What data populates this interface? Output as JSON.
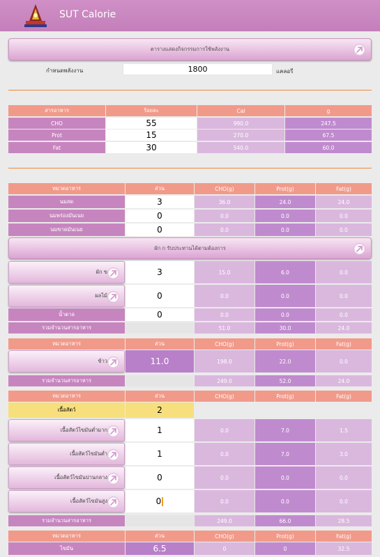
{
  "app": {
    "title": "SUT Calorie"
  },
  "activity_banner": {
    "label": "ตารางแสดงกิจกรรมการใช้พลังงาน"
  },
  "energy": {
    "label": "กำหนดพลังงาน",
    "value": "1800",
    "unit": "แคลอรี"
  },
  "nutrient_table": {
    "headers": [
      "สารอาหาร",
      "ร้อยละ",
      "Cal",
      "g"
    ],
    "rows": [
      {
        "name": "CHO",
        "percent": "55",
        "cal": "990.0",
        "g": "247.5"
      },
      {
        "name": "Prot",
        "percent": "15",
        "cal": "270.0",
        "g": "67.5"
      },
      {
        "name": "Fat",
        "percent": "30",
        "cal": "540.0",
        "g": "60.0"
      }
    ]
  },
  "food_headers": [
    "หมวดอาหาร",
    "ส่วน",
    "CHO(g)",
    "Prot(g)",
    "Fat(g)"
  ],
  "milk_rows": [
    {
      "name": "นมสด",
      "portion": "3",
      "cho": "36.0",
      "prot": "24.0",
      "fat": "24.0"
    },
    {
      "name": "นมพร่องมันเนย",
      "portion": "0",
      "cho": "0.0",
      "prot": "0.0",
      "fat": "0.0"
    },
    {
      "name": "นมขาดมันเนย",
      "portion": "0",
      "cho": "0.0",
      "prot": "0.0",
      "fat": "0.0"
    }
  ],
  "veg_banner": {
    "label": "ผัก ก  รับประทานได้ตามต้องการ"
  },
  "veg_rows": [
    {
      "name": "ผัก ข",
      "portion": "3",
      "cho": "15.0",
      "prot": "6.0",
      "fat": "0.0"
    },
    {
      "name": "ผลไม้",
      "portion": "0",
      "cho": "0.0",
      "prot": "0.0",
      "fat": "0.0"
    },
    {
      "name": "น้ำตาล",
      "portion": "0",
      "cho": "0.0",
      "prot": "0.0",
      "fat": "0.0"
    }
  ],
  "total1": {
    "label": "รวมจำนวนสารอาหาร",
    "cho": "51.0",
    "prot": "30.0",
    "fat": "24.0"
  },
  "rice_row": {
    "name": "ข้าว",
    "portion": "11.0",
    "cho": "198.0",
    "prot": "22.0",
    "fat": "0.0"
  },
  "total2": {
    "label": "รวมจำนวนสารอาหาร",
    "cho": "249.0",
    "prot": "52.0",
    "fat": "24.0"
  },
  "meat_header": {
    "name": "เนื้อสัตว์",
    "portion": "2"
  },
  "meat_rows": [
    {
      "name": "เนื้อสัตว์ไขมันต่ำมาก",
      "portion": "1",
      "cho": "0.0",
      "prot": "7.0",
      "fat": "1.5"
    },
    {
      "name": "เนื้อสัตว์ไขมันต่ำ",
      "portion": "1",
      "cho": "0.0",
      "prot": "7.0",
      "fat": "3.0"
    },
    {
      "name": "เนื้อสัตว์ไขมันปานกลาง",
      "portion": "0",
      "cho": "0.0",
      "prot": "0.0",
      "fat": "0.0"
    },
    {
      "name": "เนื้อสัตว์ไขมันสูง",
      "portion": "0",
      "cho": "0.0",
      "prot": "0.0",
      "fat": "0.0"
    }
  ],
  "total3": {
    "label": "รวมจำนวนสารอาหาร",
    "cho": "249.0",
    "prot": "66.0",
    "fat": "28.5"
  },
  "fat_row": {
    "name": "ไขมัน",
    "portion": "6.5",
    "cho": "0",
    "prot": "0",
    "fat": "32.5"
  },
  "colors": {
    "appbar": "#c47fba",
    "header_cell": "#f19a8a",
    "name_cell": "#c785bf",
    "light_cell": "#dab8de",
    "dark_cell": "#c08bce",
    "divider": "#ee8a3a",
    "highlight": "#f7df7e"
  }
}
